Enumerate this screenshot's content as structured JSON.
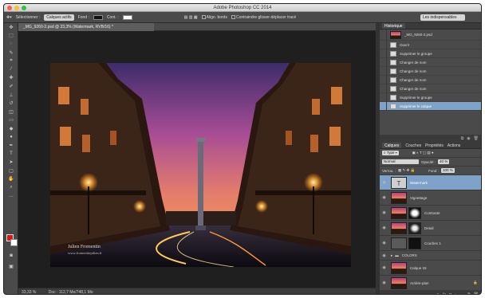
{
  "app": {
    "title": "Adobe Photoshop CC 2014"
  },
  "options_bar": {
    "select_label": "Sélectionner :",
    "select_value": "Calques actifs",
    "fill_label": "Fond :",
    "stroke_label": "Cont. :",
    "align_edges_label": "Align. bords",
    "constrain_label": "Contraindre glisser-déplacer tracé",
    "workspace_value": "Les indispensables"
  },
  "document": {
    "tab_title": "_MG_9260-2.psd @ 33,3% (Watermark, RVB/16) *",
    "watermark_line1": "Julien Fromentin",
    "watermark_line2": "www.fromentinjulien.fr"
  },
  "status": {
    "zoom": "33,33 %",
    "doc_info": "Doc : 112,7 Mo/748,1 Mo"
  },
  "history": {
    "title": "Historique",
    "snapshot": "_MG_9260-2.psd",
    "items": [
      "Ouvrir",
      "Supprimer le groupe",
      "Changer de nom",
      "Changer de nom",
      "Changer de nom",
      "Changer de nom",
      "Supprimer le groupe",
      "Supprimer le calque"
    ]
  },
  "layers_panel": {
    "tabs": [
      "Calques",
      "Couches",
      "Propriétés",
      "Actions"
    ],
    "kind_filter": "Type",
    "blend_mode": "Normal",
    "opacity_label": "Opacité :",
    "opacity_value": "40 %",
    "lock_label": "Verrou. :",
    "fill_label": "Fond :",
    "fill_value": "100 %",
    "layers": [
      "Watermark",
      "Vignettage",
      "Contraste",
      "Detail",
      "Courbes 1",
      "COLORS",
      "Calque 33",
      "Arrière-plan"
    ]
  },
  "colors": {
    "foreground": "#e21313",
    "background": "#ffffff",
    "selection": "#7ea2c8"
  }
}
